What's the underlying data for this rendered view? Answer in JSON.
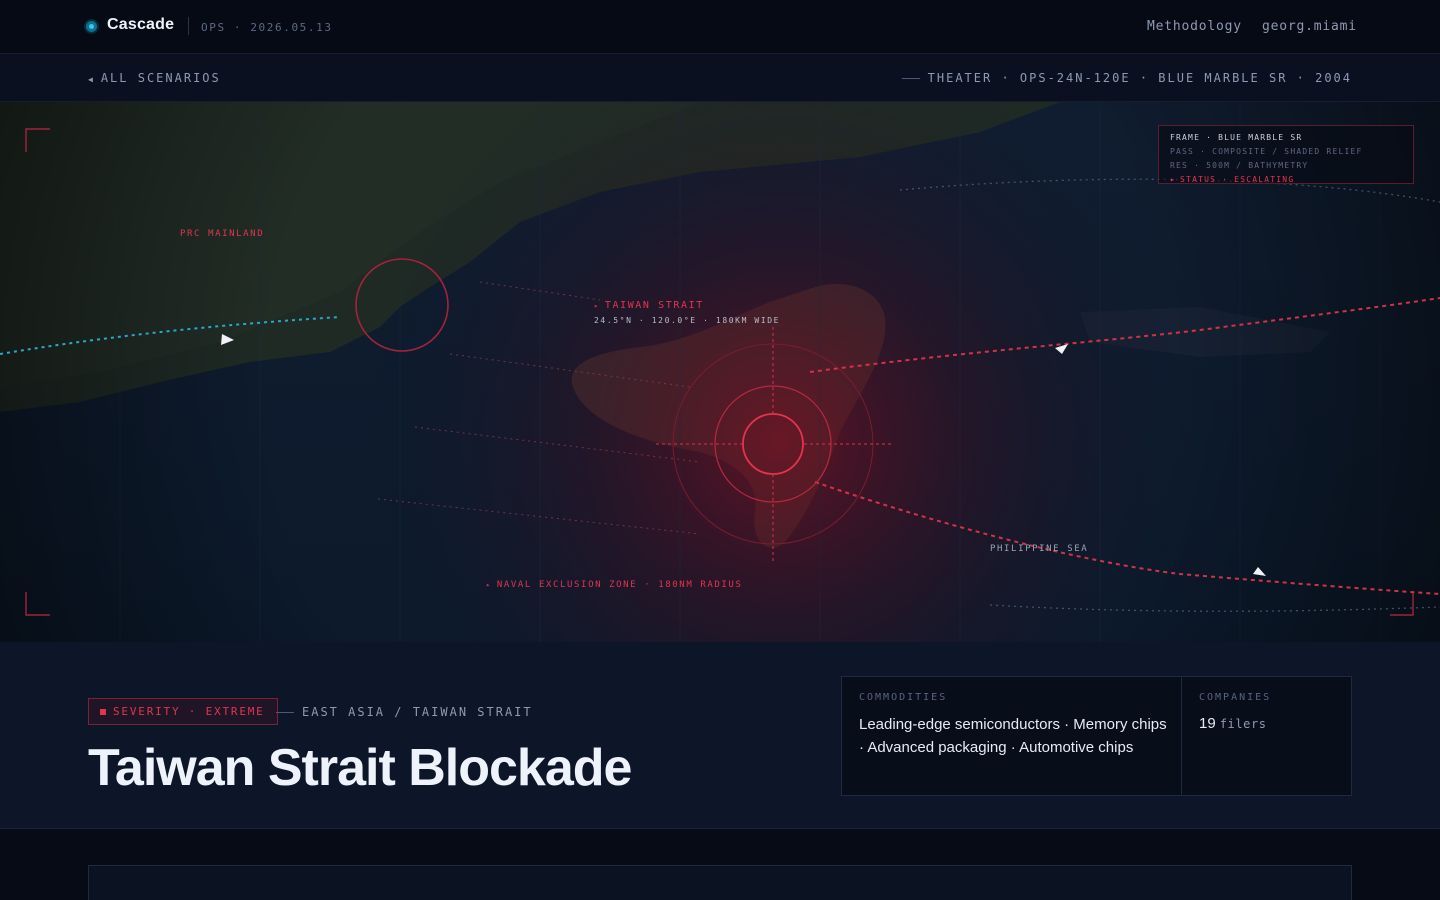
{
  "header": {
    "brand": "Cascade",
    "sub": "OPS · 2026.05.13",
    "nav": [
      "Methodology",
      "georg.miami"
    ]
  },
  "subbar": {
    "back_label": "ALL SCENARIOS",
    "theater": "THEATER · OPS-24N-120E · BLUE MARBLE SR · 2004"
  },
  "map": {
    "labels": {
      "mainland": "PRC MAINLAND",
      "strait": "TAIWAN STRAIT",
      "strait_coords": "24.5°N · 120.0°E · 180KM WIDE",
      "exclusion": "NAVAL EXCLUSION ZONE · 180NM RADIUS",
      "sea": "PHILIPPINE SEA"
    },
    "frame": {
      "line1": "FRAME · BLUE MARBLE SR",
      "line2": "PASS · COMPOSITE / SHADED RELIEF",
      "line3": "RES · 500M / BATHYMETRY",
      "line4": "STATUS · ESCALATING"
    },
    "colors": {
      "alert": "#e2344e",
      "friendly_route": "#2aa9c7"
    }
  },
  "scenario": {
    "severity": "SEVERITY · EXTREME",
    "region": "EAST ASIA / TAIWAN STRAIT",
    "title": "Taiwan Strait Blockade",
    "commodities_label": "COMMODITIES",
    "commodities": "Leading-edge semiconductors · Memory chips · Advanced packaging · Automotive chips",
    "companies_label": "COMPANIES",
    "companies_count": "19",
    "companies_unit": "filers"
  }
}
